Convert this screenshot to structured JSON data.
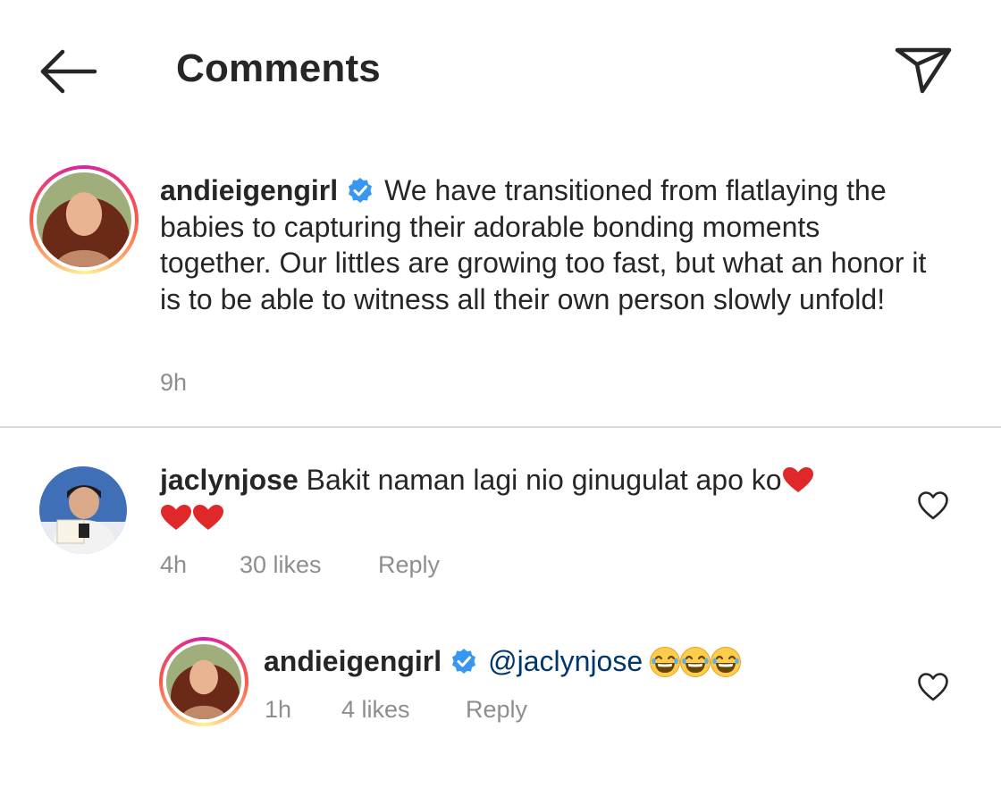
{
  "header": {
    "title": "Comments"
  },
  "caption": {
    "username": "andieigengirl",
    "text": "We have transitioned from flatlaying the babies to capturing their adorable bonding moments together. Our littles are growing too fast, but what an honor it is to be able to witness all their own person slowly unfold!",
    "time": "9h"
  },
  "comments": [
    {
      "username": "jaclynjose",
      "text": "Bakit naman lagi nio ginugulat apo ko",
      "time": "4h",
      "likes": "30 likes",
      "reply_label": "Reply"
    }
  ],
  "reply": {
    "username": "andieigengirl",
    "mention": "@jaclynjose",
    "time": "1h",
    "likes": "4 likes",
    "reply_label": "Reply"
  },
  "icons": [
    "back-arrow-icon",
    "send-icon",
    "verified-badge-icon",
    "heart-icon",
    "heart-emoji-icon",
    "laughing-emoji-icon"
  ],
  "colors": {
    "verified": "#3897f0",
    "heart_emoji": "#e0282a",
    "meta": "#8e8e8e",
    "mention": "#00376b"
  }
}
